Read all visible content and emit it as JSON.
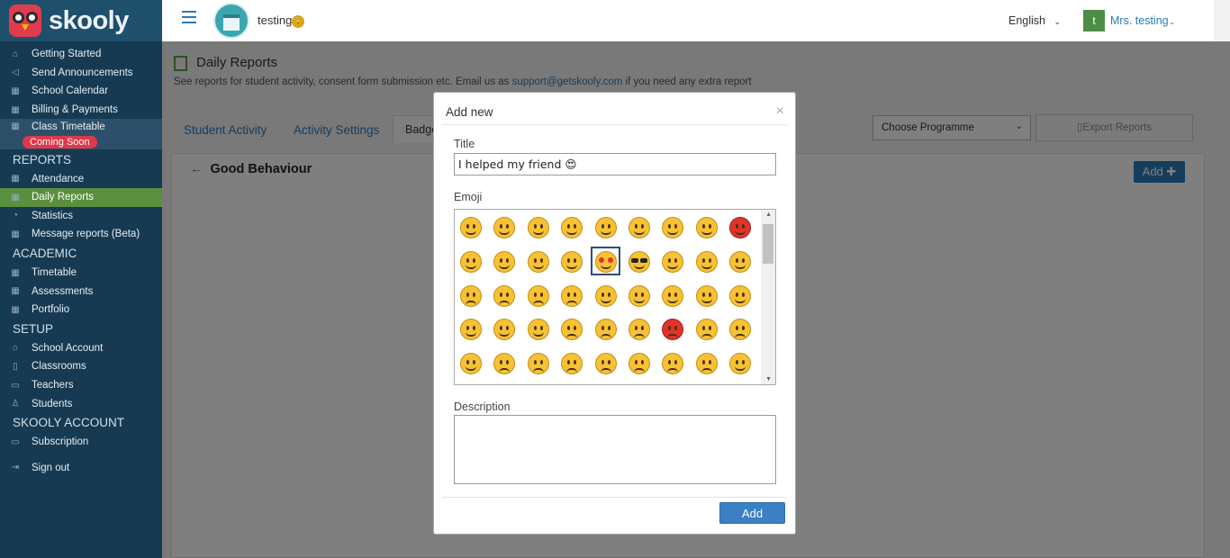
{
  "brand": {
    "name": "skooly"
  },
  "sidebar": {
    "items": [
      {
        "label": "Getting Started",
        "icon": "home-icon"
      },
      {
        "label": "Send Announcements",
        "icon": "megaphone-icon"
      },
      {
        "label": "School Calendar",
        "icon": "calendar-icon"
      },
      {
        "label": "Billing & Payments",
        "icon": "calendar-icon"
      },
      {
        "label": "Class Timetable",
        "icon": "calendar-icon"
      }
    ],
    "coming_soon": "Coming Soon",
    "reports_head": "REPORTS",
    "reports": [
      {
        "label": "Attendance",
        "icon": "calendar-icon"
      },
      {
        "label": "Daily Reports",
        "icon": "calendar-icon"
      },
      {
        "label": "Statistics",
        "icon": "pie-chart-icon"
      },
      {
        "label": "Message reports (Beta)",
        "icon": "calendar-icon"
      }
    ],
    "academic_head": "ACADEMIC",
    "academic": [
      {
        "label": "Timetable",
        "icon": "calendar-icon"
      },
      {
        "label": "Assessments",
        "icon": "calendar-icon"
      },
      {
        "label": "Portfolio",
        "icon": "calendar-icon"
      }
    ],
    "setup_head": "SETUP",
    "setup": [
      {
        "label": "School Account",
        "icon": "bank-icon"
      },
      {
        "label": "Classrooms",
        "icon": "building-icon"
      },
      {
        "label": "Teachers",
        "icon": "board-icon"
      },
      {
        "label": "Students",
        "icon": "student-icon"
      }
    ],
    "account_head": "SKOOLY ACCOUNT",
    "account": [
      {
        "label": "Subscription",
        "icon": "bookmark-icon"
      }
    ],
    "signout": "Sign out"
  },
  "topbar": {
    "school_name": "testing",
    "language": "English",
    "avatar_letter": "t",
    "user": "Mrs. testing"
  },
  "page": {
    "title": "Daily Reports",
    "subtitle_pre": "See reports for student activity, consent form submission etc. Email us as",
    "email": "support@getskooly.com",
    "subtitle_post": "if you need any extra report",
    "tabs": [
      "Student Activity",
      "Activity Settings",
      "Badge"
    ],
    "programme_placeholder": "Choose Programme",
    "export_label": "Export Reports",
    "section_title": "Good Behaviour",
    "add_label": "Add"
  },
  "modal": {
    "title": "Add new",
    "title_label": "Title",
    "title_value": "I helped my friend 😍",
    "emoji_label": "Emoji",
    "description_label": "Description",
    "add_button": "Add",
    "selected_emoji_index": 13,
    "emojis": [
      "grinning",
      "grin",
      "joy",
      "smiley",
      "smile",
      "sweat-smile",
      "laughing",
      "innocent",
      "smiling-imp",
      "wink",
      "blush",
      "yum",
      "relieved",
      "heart-eyes",
      "sunglasses",
      "smirk",
      "neutral",
      "expressionless",
      "unamused",
      "sweat",
      "pensive",
      "confused",
      "confounded",
      "kissing",
      "kissing-heart",
      "kissing-smiling",
      "kissing-closed",
      "tongue",
      "tongue-wink",
      "tongue-closed",
      "disappointed",
      "worried",
      "angry",
      "rage",
      "cry",
      "persevere",
      "triumph",
      "disappointed-relieved",
      "frowning",
      "anguished",
      "fearful",
      "weary",
      "sleepy",
      "tired",
      "grimacing"
    ]
  },
  "colors": {
    "sidebar_bg": "#163a51",
    "accent": "#2a7ab8",
    "active": "#5a8f3e",
    "badge": "#e0384b"
  }
}
